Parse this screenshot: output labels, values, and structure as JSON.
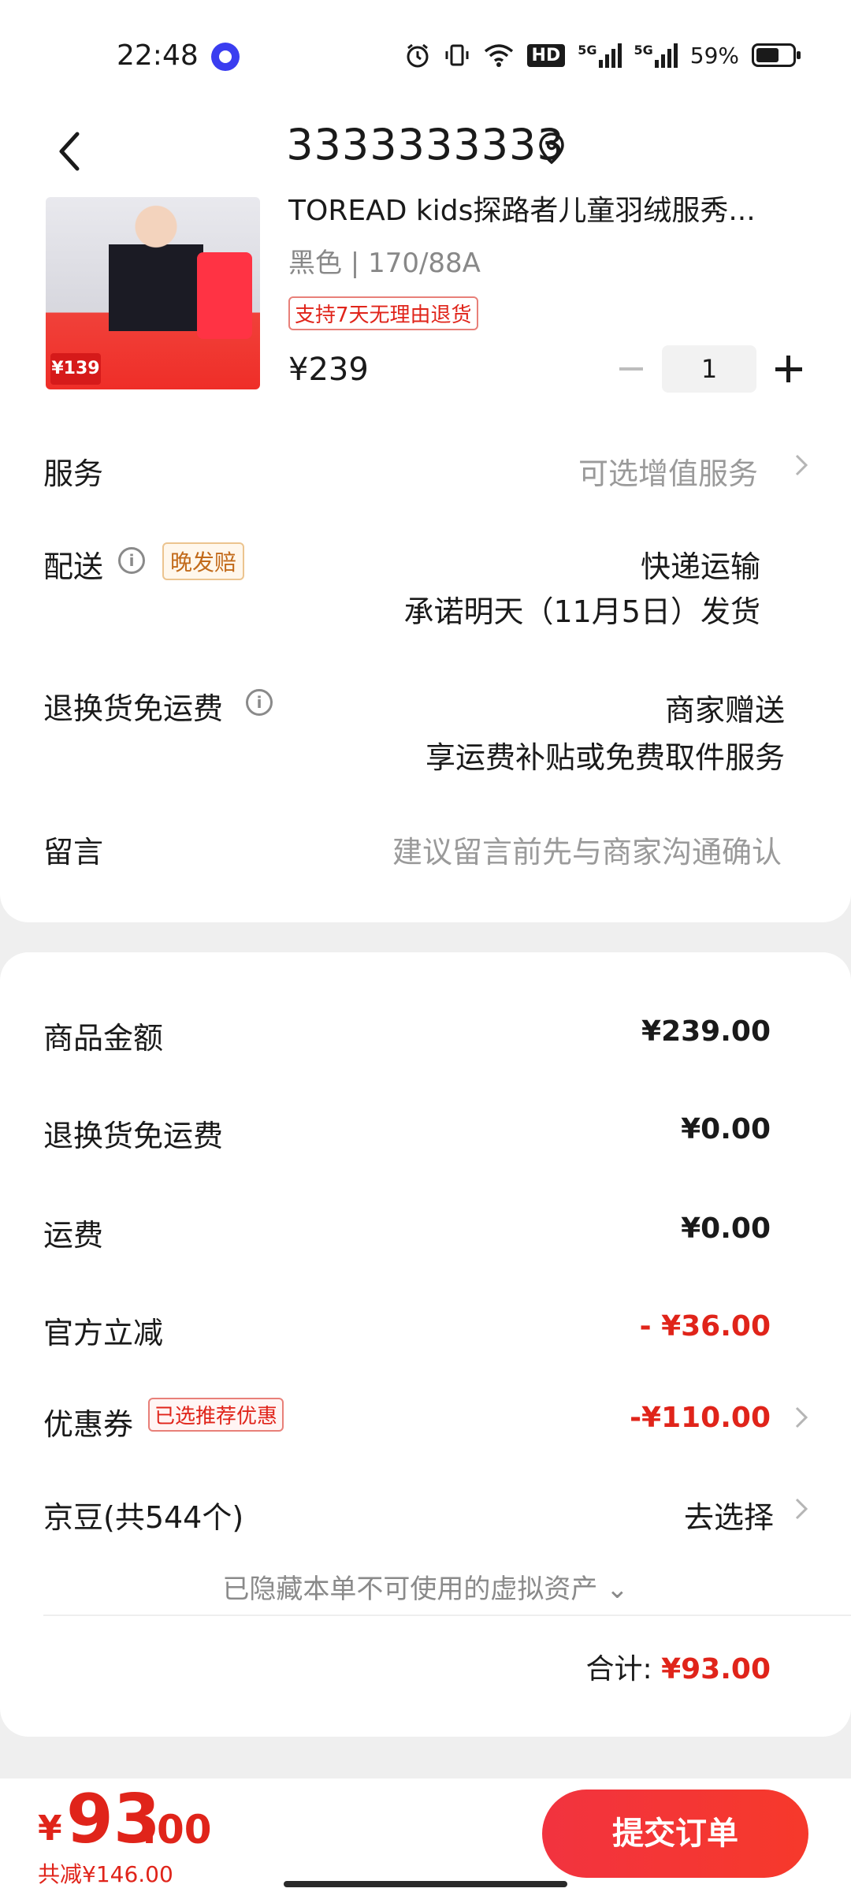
{
  "status_bar": {
    "time": "22:48",
    "network_5g_1": "5G",
    "network_5g_2": "5G",
    "hd_label": "HD",
    "battery_percent": "59%",
    "battery_level": 0.59,
    "icons": [
      "app-notification-icon",
      "alarm-icon",
      "vibrate-icon",
      "wifi-icon",
      "hd-icon",
      "signal-icon",
      "signal-icon",
      "battery-icon"
    ]
  },
  "nav": {
    "title": "3333333333",
    "back_icon": "back-arrow-icon",
    "pin_icon": "location-pin-icon"
  },
  "product": {
    "name": "TOREAD kids探路者儿童羽绒服秀...",
    "variant": "黑色 | 170/88A",
    "return_tag": "支持7天无理由退货",
    "price": "¥239",
    "quantity": "1",
    "thumb_price": "¥139"
  },
  "service": {
    "label": "服务",
    "value": "可选增值服务"
  },
  "delivery": {
    "label": "配送",
    "tag": "晚发赔",
    "method": "快递运输",
    "promise": "承诺明天（11月5日）发货"
  },
  "return_shipping": {
    "label": "退换货免运费",
    "value1": "商家赠送",
    "value2": "享运费补贴或免费取件服务"
  },
  "message": {
    "label": "留言",
    "placeholder": "建议留言前先与商家沟通确认"
  },
  "fees": {
    "goods_label": "商品金额",
    "goods_value": "¥239.00",
    "return_fee_label": "退换货免运费",
    "return_fee_value": "¥0.00",
    "shipping_label": "运费",
    "shipping_value": "¥0.00",
    "official_label": "官方立减",
    "official_value": "- ¥36.00",
    "coupon_label": "优惠券",
    "coupon_tag": "已选推荐优惠",
    "coupon_value": "-¥110.00",
    "jingdou_label": "京豆(共544个)",
    "jingdou_value": "去选择",
    "hidden_note": "已隐藏本单不可使用的虚拟资产 ⌄",
    "total_label": "合计:",
    "total_value": "¥93.00"
  },
  "bottom": {
    "currency": "¥",
    "amount_int": "93",
    "amount_dec": ".00",
    "saved": "共减¥146.00",
    "submit": "提交订单"
  },
  "colors": {
    "accent_red": "#e0241a",
    "button_red": "#f2333f",
    "tag_orange": "#c26a1a",
    "background": "#efefef"
  }
}
